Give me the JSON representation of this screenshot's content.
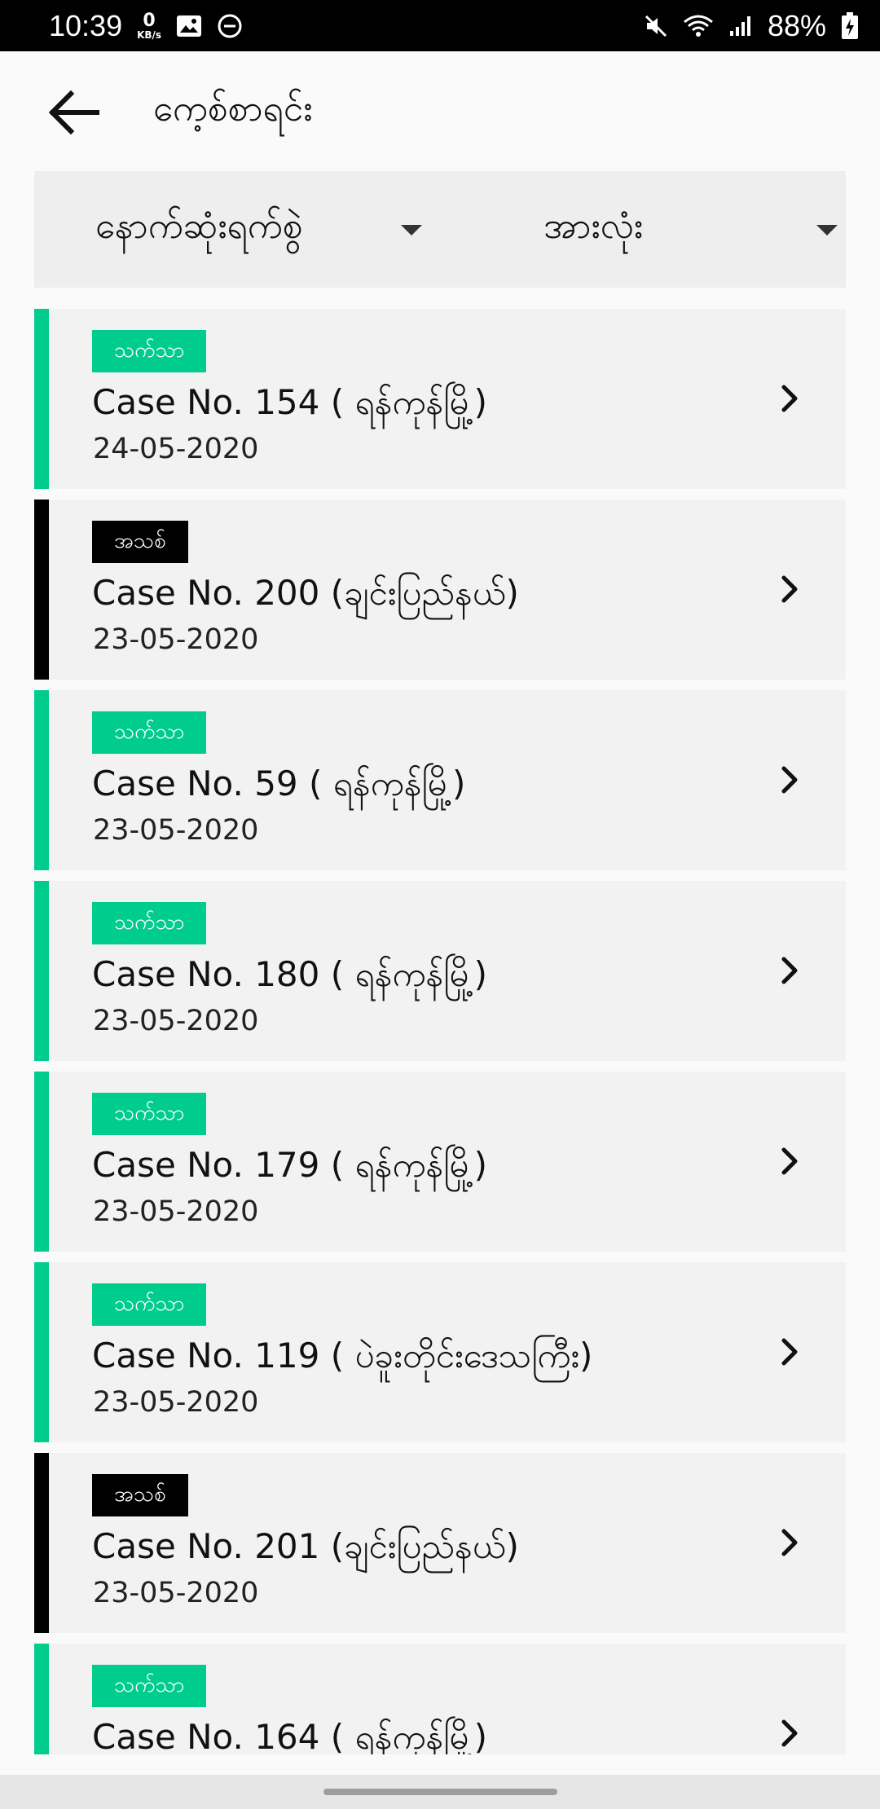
{
  "status_bar": {
    "time": "10:39",
    "net_speed_value": "0",
    "net_speed_unit": "KB/s",
    "battery": "88%"
  },
  "app_bar": {
    "title": "ကေ့စ်စာရင်း"
  },
  "filters": {
    "sort_label": "နောက်ဆုံးရက်စွဲ",
    "status_label": "အားလုံး"
  },
  "colors": {
    "active": "#00cc8e",
    "new": "#000000"
  },
  "cases": [
    {
      "badge": "သက်သာ",
      "badge_type": "active",
      "title": "Case No. 154 ( ရန်ကုန်မြို့)",
      "date": "24-05-2020"
    },
    {
      "badge": "အသစ်",
      "badge_type": "new",
      "title": "Case No. 200 (ချင်းပြည်နယ်)",
      "date": "23-05-2020"
    },
    {
      "badge": "သက်သာ",
      "badge_type": "active",
      "title": "Case No. 59 ( ရန်ကုန်မြို့)",
      "date": "23-05-2020"
    },
    {
      "badge": "သက်သာ",
      "badge_type": "active",
      "title": "Case No. 180 ( ရန်ကုန်မြို့)",
      "date": "23-05-2020"
    },
    {
      "badge": "သက်သာ",
      "badge_type": "active",
      "title": "Case No. 179 ( ရန်ကုန်မြို့)",
      "date": "23-05-2020"
    },
    {
      "badge": "သက်သာ",
      "badge_type": "active",
      "title": "Case No. 119 ( ပဲခူးတိုင်းဒေသကြီး)",
      "date": "23-05-2020"
    },
    {
      "badge": "အသစ်",
      "badge_type": "new",
      "title": "Case No. 201 (ချင်းပြည်နယ်)",
      "date": "23-05-2020"
    },
    {
      "badge": "သက်သာ",
      "badge_type": "active",
      "title": "Case No. 164 ( ရန်ကုန်မြို့)",
      "date": ""
    }
  ]
}
